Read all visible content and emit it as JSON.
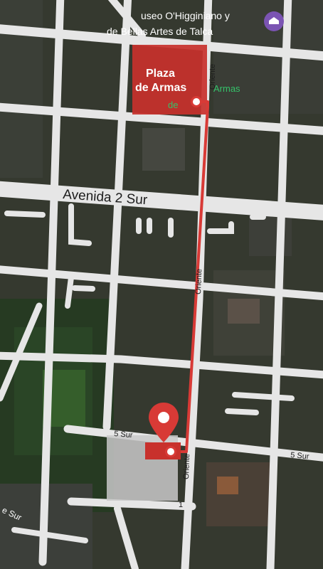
{
  "map": {
    "plaza_label_line1": "Plaza",
    "plaza_label_line2": "de Armas",
    "avenue_label": "Avenida 2 Sur",
    "street_5_sur_left": "5   Sur",
    "street_5_sur_right": "5   Sur",
    "oriente_top": "Oriente",
    "oriente_middle": "Oriente",
    "oriente_bottom": "Oriente",
    "oriente_bottom_number": "1",
    "museum_line1": "useo O'Higginiano y",
    "museum_line2": "de Bellas Artes de Talca",
    "plaza_green_line1": "Armas",
    "plaza_green_line2": "de",
    "sw_label": "e Sur",
    "museum_icon": "museum-icon",
    "colors": {
      "route": "#d83a36",
      "plaza": "#c8312c",
      "destination": "#d83a36",
      "road": "#e8e8e8",
      "poi_purple": "#7b54b3",
      "poi_green": "#35c26a"
    }
  },
  "route": {
    "origin_name": "Plaza de Armas",
    "destination_street": "5 Sur"
  }
}
